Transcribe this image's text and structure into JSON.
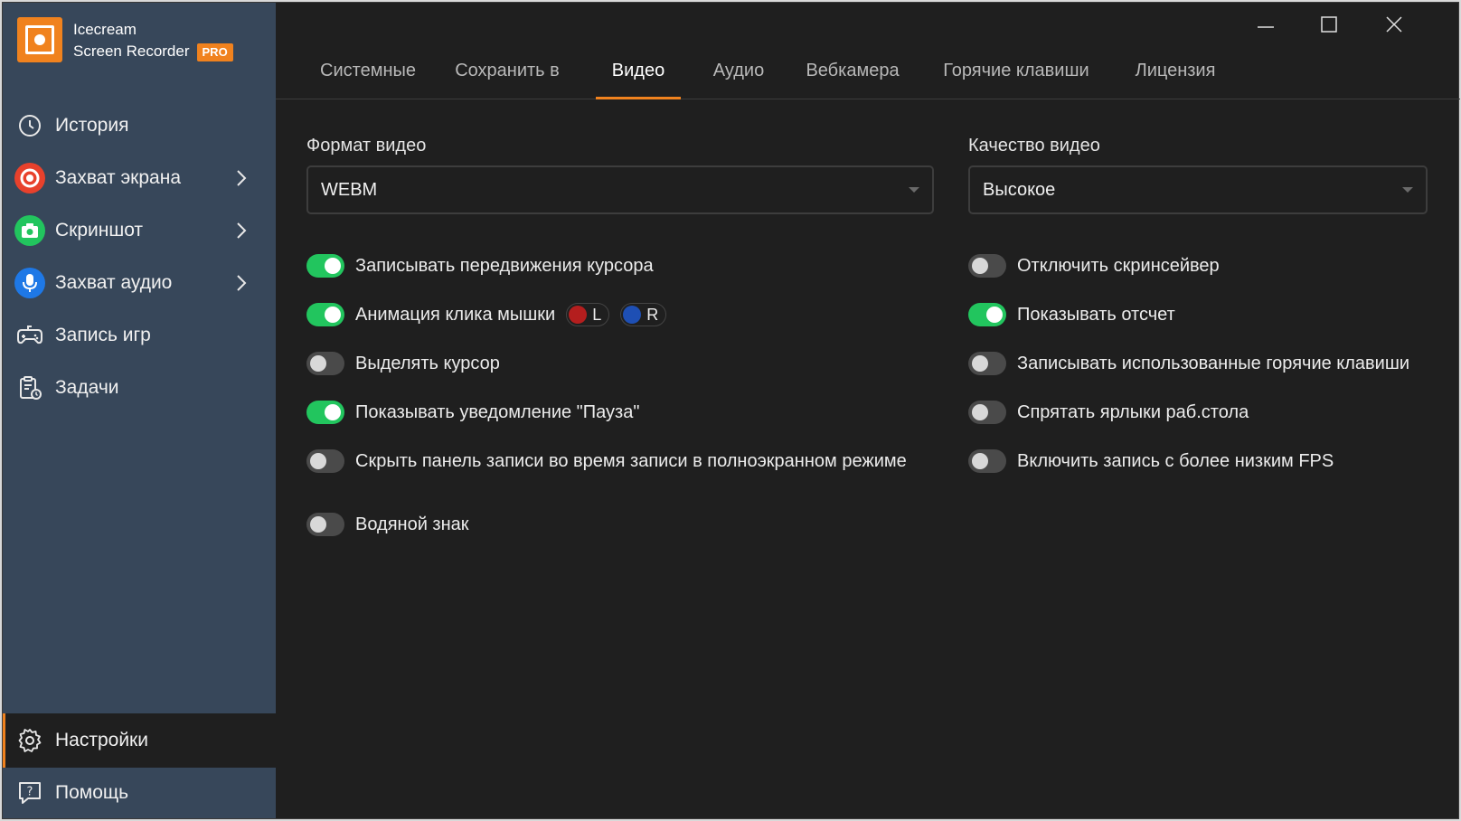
{
  "app": {
    "name_line1": "Icecream",
    "name_line2": "Screen Recorder",
    "badge": "PRO",
    "accent": "#f0821e"
  },
  "sidebar": {
    "items": [
      {
        "label": "История",
        "icon": "clock-icon"
      },
      {
        "label": "Захват экрана",
        "icon": "record-icon",
        "color": "#e8412c"
      },
      {
        "label": "Скриншот",
        "icon": "camera-icon",
        "color": "#22c55e"
      },
      {
        "label": "Захват аудио",
        "icon": "microphone-icon",
        "color": "#1e78e6"
      },
      {
        "label": "Запись игр",
        "icon": "gamepad-icon"
      },
      {
        "label": "Задачи",
        "icon": "tasks-icon"
      }
    ],
    "settings": "Настройки",
    "help": "Помощь"
  },
  "tabs": [
    "Системные",
    "Сохранить в",
    "Видео",
    "Аудио",
    "Вебкамера",
    "Горячие клавиши",
    "Лицензия"
  ],
  "active_tab": "Видео",
  "video": {
    "format_label": "Формат видео",
    "format_value": "WEBM",
    "quality_label": "Качество видео",
    "quality_value": "Высокое"
  },
  "options_left": [
    {
      "label": "Записывать передвижения курсора",
      "on": true
    },
    {
      "label": "Анимация клика мышки",
      "on": true
    },
    {
      "label": "Выделять курсор",
      "on": false
    },
    {
      "label": "Показывать уведомление \"Пауза\"",
      "on": true
    },
    {
      "label": "Скрыть панель записи во время записи в полноэкранном режиме",
      "on": false
    },
    {
      "label": "Водяной знак",
      "on": false
    }
  ],
  "mouse_buttons": {
    "left_label": "L",
    "left_color": "#b41e1e",
    "right_label": "R",
    "right_color": "#1e4fb4"
  },
  "options_right": [
    {
      "label": "Отключить скринсейвер",
      "on": false
    },
    {
      "label": "Показывать отсчет",
      "on": true
    },
    {
      "label": "Записывать использованные горячие клавиши",
      "on": false
    },
    {
      "label": "Спрятать ярлыки раб.стола",
      "on": false
    },
    {
      "label": "Включить запись с более низким FPS",
      "on": false
    }
  ]
}
